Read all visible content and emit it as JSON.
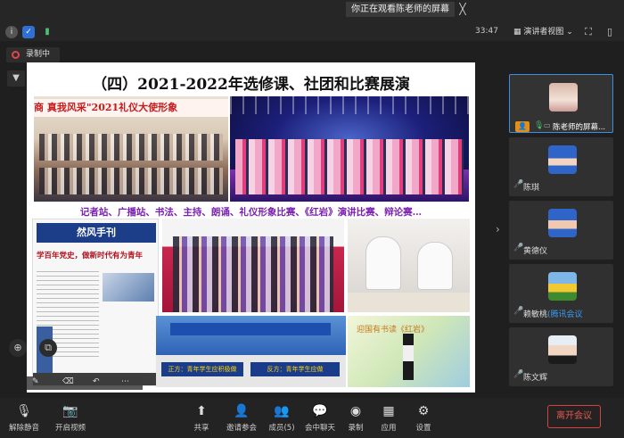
{
  "banner": {
    "text": "你正在观看陈老师的屏幕",
    "close": "╳"
  },
  "status": {
    "time": "33:47",
    "view_label": "演讲者视图"
  },
  "recording": {
    "label": "录制中"
  },
  "slide": {
    "title": "（四）2021-2022年选修课、社团和比赛展演",
    "photo1_caption": "商  真我风采\"2021礼仪大使形象",
    "activities_caption": "记者站、广播站、书法、主持、朗诵、礼仪形象比赛、《红岩》演讲比赛、辩论赛…",
    "newspaper_masthead": "然风手刊",
    "newspaper_headline": "学百年党史，做新时代有为青年",
    "sign1": "正方：青年学生应积极做",
    "sign2": "反方：青年学生应做",
    "photo7_title": "迎国有书读《红岩》"
  },
  "participants": [
    {
      "name": "陈老师的屏幕...",
      "role": "host"
    },
    {
      "name": "陈琪"
    },
    {
      "name": "黄德仪"
    },
    {
      "name": "赖敏桃",
      "suffix": "(腾讯会议"
    },
    {
      "name": "陈文辉"
    }
  ],
  "toolbar": {
    "mute": "解除静音",
    "video": "开启视频",
    "share": "共享",
    "invite": "邀请参会",
    "members": "成员(5)",
    "chat": "会中聊天",
    "record": "录制",
    "apps": "应用",
    "settings": "设置",
    "leave": "离开会议"
  },
  "colors": {
    "accent": "#3b8fde",
    "leave": "#e8554f",
    "recording": "#e64545"
  }
}
